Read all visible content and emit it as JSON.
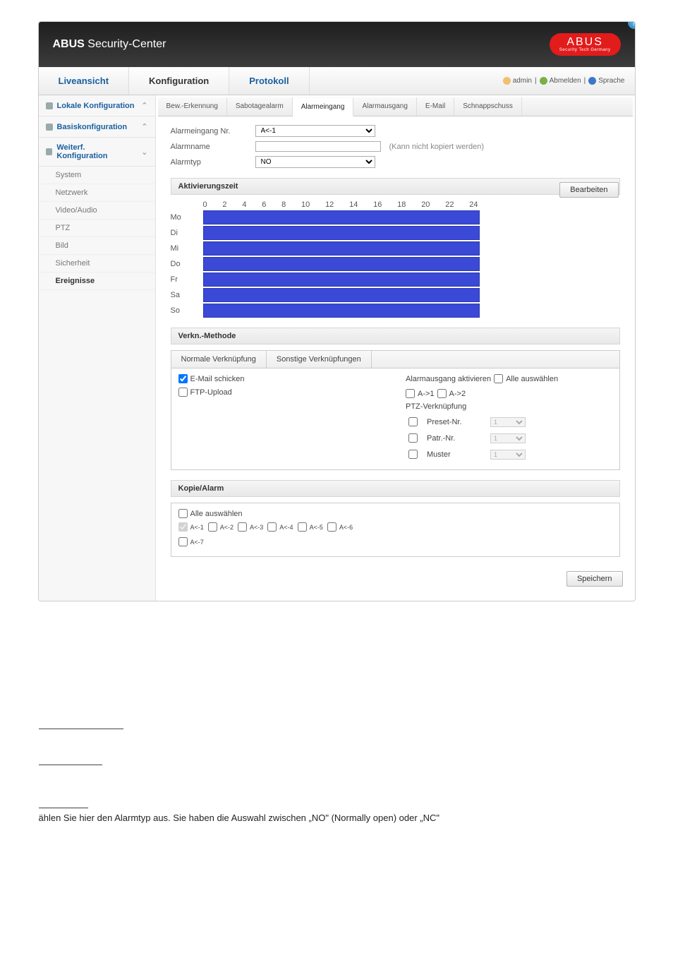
{
  "header": {
    "title_bold": "ABUS",
    "title_rest": " Security-Center",
    "logo_main": "ABUS",
    "logo_sub": "Security Tech Germany",
    "help": "?"
  },
  "topnav": {
    "tabs": [
      "Liveansicht",
      "Konfiguration",
      "Protokoll"
    ],
    "active": 1,
    "user": "admin",
    "logout": "Abmelden",
    "lang": "Sprache"
  },
  "sidebar": {
    "groups": [
      {
        "label": "Lokale Konfiguration",
        "open": false
      },
      {
        "label": "Basiskonfiguration",
        "open": false
      },
      {
        "label": "Weiterf. Konfiguration",
        "open": true,
        "subs": [
          "System",
          "Netzwerk",
          "Video/Audio",
          "PTZ",
          "Bild",
          "Sicherheit",
          "Ereignisse"
        ],
        "selected": 6
      }
    ]
  },
  "subtabs": {
    "items": [
      "Bew.-Erkennung",
      "Sabotagealarm",
      "Alarmeingang",
      "Alarmausgang",
      "E-Mail",
      "Schnappschuss"
    ],
    "active": 2
  },
  "form": {
    "alarm_in_label": "Alarmeingang Nr.",
    "alarm_in_value": "A<-1",
    "alarm_name_label": "Alarmname",
    "alarm_name_value": "",
    "alarm_name_hint": "(Kann nicht kopiert werden)",
    "alarm_type_label": "Alarmtyp",
    "alarm_type_value": "NO"
  },
  "schedule": {
    "section": "Aktivierungszeit",
    "edit": "Bearbeiten",
    "ticks": [
      "0",
      "2",
      "4",
      "6",
      "8",
      "10",
      "12",
      "14",
      "16",
      "18",
      "20",
      "22",
      "24"
    ],
    "days": [
      "Mo",
      "Di",
      "Mi",
      "Do",
      "Fr",
      "Sa",
      "So"
    ]
  },
  "link": {
    "section": "Verkn.-Methode",
    "tabs": [
      "Normale Verknüpfung",
      "Sonstige Verknüpfungen"
    ],
    "left": [
      {
        "label": "E-Mail schicken",
        "checked": true
      },
      {
        "label": "FTP-Upload",
        "checked": false
      }
    ],
    "right_title": "Alarmausgang aktivieren",
    "right_all": "Alle auswählen",
    "outs": [
      "A->1",
      "A->2"
    ],
    "ptz_title": "PTZ-Verknüpfung",
    "ptz": [
      {
        "label": "Preset-Nr.",
        "val": "1"
      },
      {
        "label": "Patr.-Nr.",
        "val": "1"
      },
      {
        "label": "Muster",
        "val": "1"
      }
    ]
  },
  "copy": {
    "section": "Kopie/Alarm",
    "all": "Alle auswählen",
    "items": [
      "A<-1",
      "A<-2",
      "A<-3",
      "A<-4",
      "A<-5",
      "A<-6",
      "A<-7"
    ]
  },
  "save": "Speichern",
  "foot": "ählen Sie hier den Alarmtyp aus. Sie haben die Auswahl zwischen „NO\" (Normally open) oder „NC\""
}
